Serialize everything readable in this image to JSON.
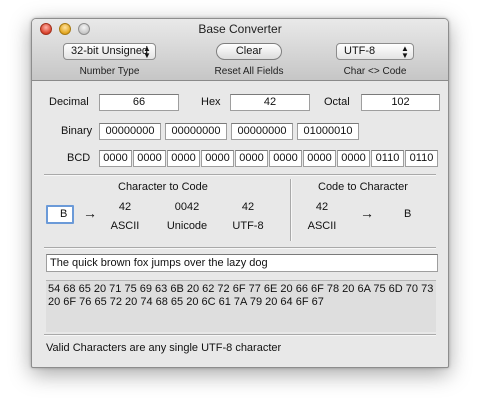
{
  "window": {
    "title": "Base Converter"
  },
  "toolbar": {
    "number_type": {
      "value": "32-bit Unsigned",
      "label": "Number Type"
    },
    "clear": {
      "value": "Clear",
      "label": "Reset All Fields"
    },
    "encoding": {
      "value": "UTF-8",
      "label": "Char <> Code"
    }
  },
  "fields": {
    "decimal_label": "Decimal",
    "decimal": "66",
    "hex_label": "Hex",
    "hex": "42",
    "octal_label": "Octal",
    "octal": "102",
    "binary_label": "Binary",
    "binary": [
      "00000000",
      "00000000",
      "00000000",
      "01000010"
    ],
    "bcd_label": "BCD",
    "bcd": [
      "0000",
      "0000",
      "0000",
      "0000",
      "0000",
      "0000",
      "0000",
      "0000",
      "0110",
      "0110"
    ]
  },
  "char_to_code": {
    "heading": "Character to Code",
    "input": "B",
    "arrow": "→",
    "ascii": "42",
    "ascii_label": "ASCII",
    "unicode": "0042",
    "unicode_label": "Unicode",
    "utf8": "42",
    "utf8_label": "UTF-8"
  },
  "code_to_char": {
    "heading": "Code to Character",
    "code": "42",
    "code_label": "ASCII",
    "arrow": "→",
    "char": "B"
  },
  "text_input": "The quick brown fox jumps over the lazy dog",
  "hex_output": "54 68 65 20 71 75 69 63 6B 20 62 72 6F 77 6E 20 66 6F 78 20 6A 75 6D 70 73 20 6F 76 65 72 20 74 68 65 20 6C 61 7A 79 20 64 6F 67",
  "status": "Valid Characters are any single UTF-8 character",
  "colors": {
    "focus": "#6b9ad8",
    "close": "#d9412b",
    "minimize": "#e2a51f"
  }
}
